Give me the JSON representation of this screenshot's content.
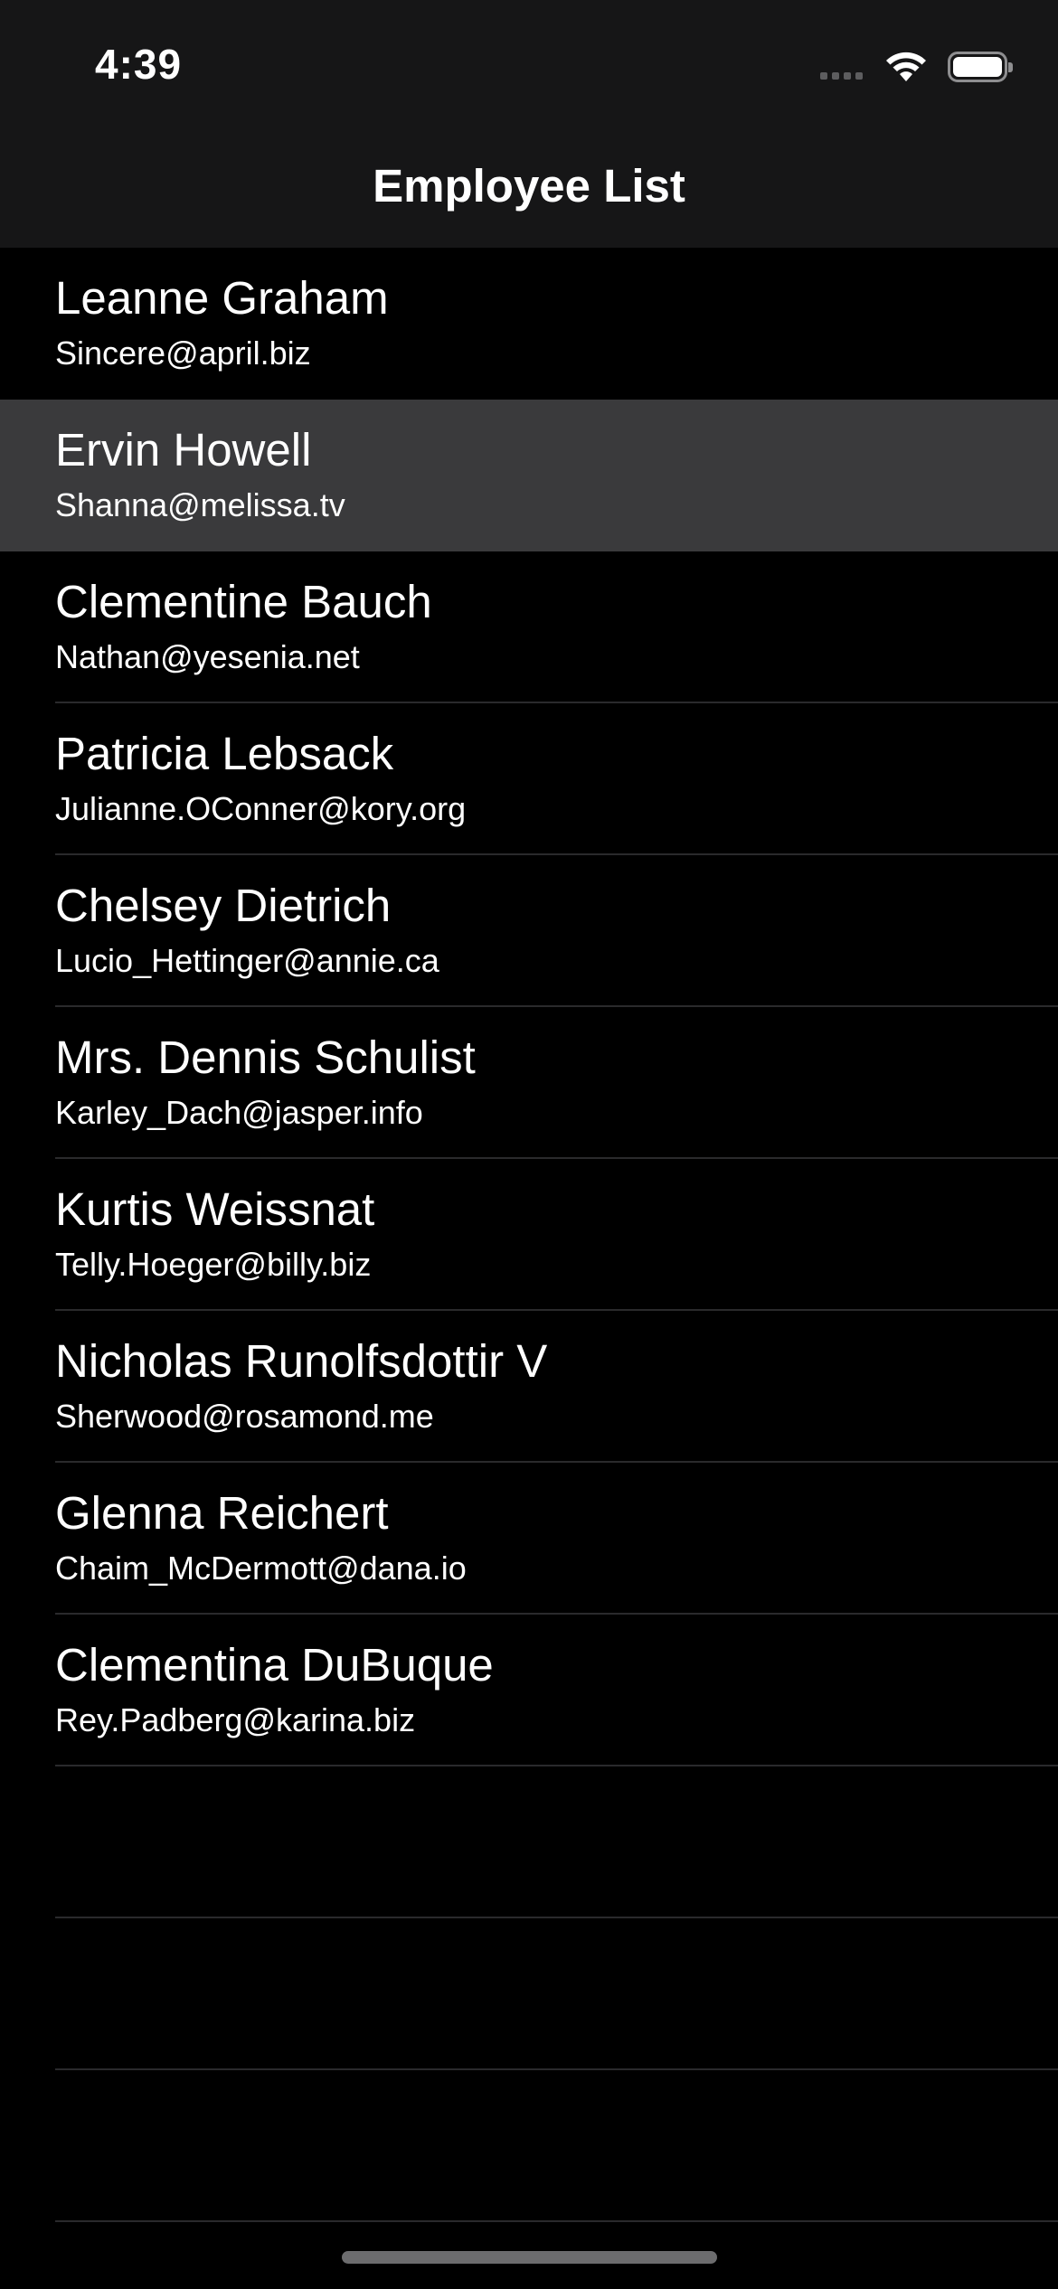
{
  "status_bar": {
    "time": "4:39"
  },
  "nav": {
    "title": "Employee List"
  },
  "employees": [
    {
      "name": "Leanne Graham",
      "email": "Sincere@april.biz",
      "selected": false
    },
    {
      "name": "Ervin Howell",
      "email": "Shanna@melissa.tv",
      "selected": true
    },
    {
      "name": "Clementine Bauch",
      "email": "Nathan@yesenia.net",
      "selected": false
    },
    {
      "name": "Patricia Lebsack",
      "email": "Julianne.OConner@kory.org",
      "selected": false
    },
    {
      "name": "Chelsey Dietrich",
      "email": "Lucio_Hettinger@annie.ca",
      "selected": false
    },
    {
      "name": "Mrs. Dennis Schulist",
      "email": "Karley_Dach@jasper.info",
      "selected": false
    },
    {
      "name": "Kurtis Weissnat",
      "email": "Telly.Hoeger@billy.biz",
      "selected": false
    },
    {
      "name": "Nicholas Runolfsdottir V",
      "email": "Sherwood@rosamond.me",
      "selected": false
    },
    {
      "name": "Glenna Reichert",
      "email": "Chaim_McDermott@dana.io",
      "selected": false
    },
    {
      "name": "Clementina DuBuque",
      "email": "Rey.Padberg@karina.biz",
      "selected": false
    }
  ],
  "colors": {
    "background": "#000000",
    "nav_background": "#161617",
    "selected_row": "#3a3a3c",
    "separator": "#2a2a2c",
    "text": "#ffffff"
  }
}
